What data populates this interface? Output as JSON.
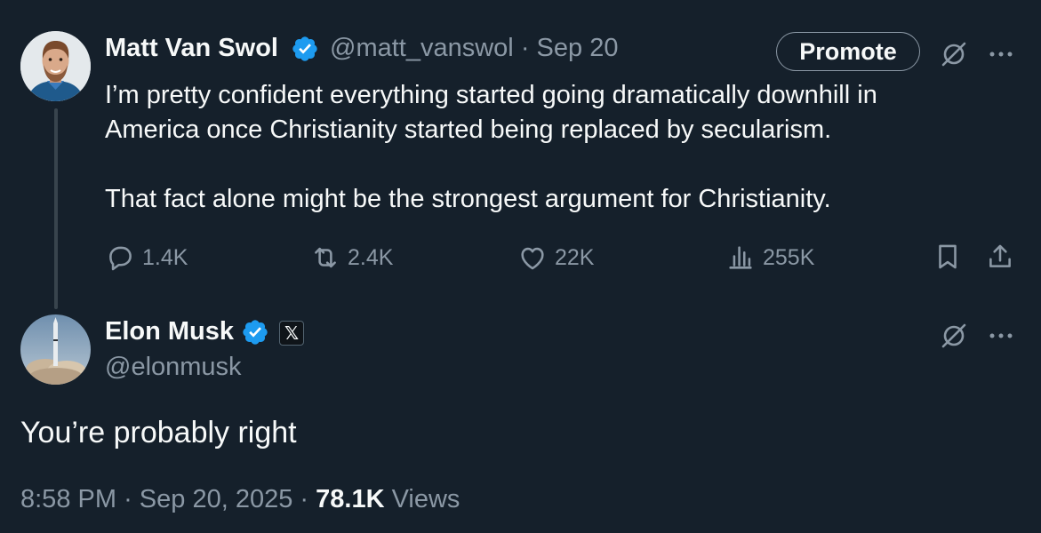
{
  "parent_tweet": {
    "author_name": "Matt Van Swol",
    "handle": "@matt_vanswol",
    "separator": "·",
    "date": "Sep 20",
    "promote_label": "Promote",
    "text_paragraphs": [
      "I’m pretty confident everything started going dramatically downhill in America once Christianity started being replaced by secularism.",
      "That fact alone might be the strongest argument for Christianity."
    ],
    "actions": {
      "replies": "1.4K",
      "reposts": "2.4K",
      "likes": "22K",
      "views": "255K"
    },
    "icons": {
      "verified": "verified-badge-icon",
      "grok": "grok-icon",
      "more": "more-icon",
      "reply": "reply-icon",
      "repost": "repost-icon",
      "like": "heart-icon",
      "views": "views-icon",
      "bookmark": "bookmark-icon",
      "share": "share-icon"
    }
  },
  "reply_tweet": {
    "author_name": "Elon Musk",
    "handle": "@elonmusk",
    "affiliation_badge": "𝕏",
    "text": "You’re probably right",
    "time": "8:58 PM",
    "separator": "·",
    "date": "Sep 20, 2025",
    "views_count": "78.1K",
    "views_label": "Views"
  },
  "colors": {
    "background": "#15202b",
    "text": "#f7f9f9",
    "muted": "#8b98a5",
    "verified": "#1d9bf0",
    "divider": "#38444d"
  }
}
